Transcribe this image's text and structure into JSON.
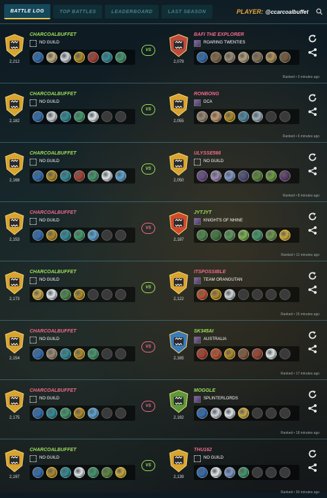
{
  "nav": {
    "tabs": [
      "BATTLE LOG",
      "TOP BATTLES",
      "LEADERBOARD",
      "LAST SEASON"
    ],
    "player_label": "PLAYER:",
    "player_name": "@ccarcoalbuffet"
  },
  "colors": {
    "win": "#9ee05a",
    "loss": "#f06a8a",
    "accent": "#e9a83a"
  },
  "battles": [
    {
      "result": "win",
      "vs": "VS",
      "ranked": "Ranked • 3 minutes ago",
      "left": {
        "name": "CHARCOALBUFFET",
        "guild": "NO GUILD",
        "rating": "2,212",
        "emblem": "gold-shield",
        "team": [
          "blue-splinter",
          "dragon",
          "wolf",
          "golden-warrior",
          "red-beast",
          "crab",
          "green-mage"
        ]
      },
      "right": {
        "name": "BAFI THE EXPLORER",
        "guild": "ROARING TWENTIES",
        "rating": "2,079",
        "emblem": "red-banner-shield",
        "team": [
          "blue-splinter",
          "beast",
          "golem",
          "fighter",
          "spearman",
          "shield-knight",
          "brown-beast"
        ]
      }
    },
    {
      "result": "win",
      "vs": "VS",
      "ranked": "Ranked • 6 minutes ago",
      "left": {
        "name": "CHARCOALBUFFET",
        "guild": "NO GUILD",
        "rating": "2,182",
        "emblem": "gold-shield",
        "team": [
          "blue-splinter",
          "wolf",
          "crab",
          "green-mage",
          "white-spirit",
          "empty",
          "empty"
        ]
      },
      "right": {
        "name": "RONBONG",
        "guild": "DCA",
        "rating": "2,055",
        "emblem": "gold-shield",
        "team": [
          "golem",
          "cat",
          "golden-warrior",
          "sea-creature",
          "mage",
          "empty",
          "empty"
        ]
      }
    },
    {
      "result": "win",
      "vs": "VS",
      "ranked": "Ranked • 8 minutes ago",
      "left": {
        "name": "CHARCOALBUFFET",
        "guild": "NO GUILD",
        "rating": "2,168",
        "emblem": "gold-shield",
        "team": [
          "blue-splinter",
          "golden-warrior",
          "crab",
          "red-beast",
          "green-mage",
          "white-spirit",
          "blue-mage"
        ]
      },
      "right": {
        "name": "ULYSSE566",
        "guild": "NO GUILD",
        "rating": "2,050",
        "emblem": "gold-shield",
        "team": [
          "purple-demon",
          "ghost",
          "spirit",
          "dark-knight",
          "beetle",
          "green-lizard",
          "shadow"
        ]
      }
    },
    {
      "result": "loss",
      "vs": "VS",
      "ranked": "Ranked • 11 minutes ago",
      "left": {
        "name": "CHARCOALBUFFET",
        "guild": "NO GUILD",
        "rating": "2,153",
        "emblem": "gold-shield",
        "team": [
          "blue-splinter",
          "golden-warrior",
          "crab",
          "green-mage",
          "blue-mage",
          "empty",
          "empty"
        ]
      },
      "right": {
        "name": "JYTJYT",
        "guild": "KNIGHTS OF NHINE",
        "rating": "2,187",
        "emblem": "fire-shield",
        "team": [
          "green-beast",
          "plant",
          "tree-spirit",
          "leaf",
          "green-mage",
          "shaman",
          "golden-elf"
        ]
      }
    },
    {
      "result": "win",
      "vs": "VS",
      "ranked": "Ranked • 15 minutes ago",
      "left": {
        "name": "CHARCOALBUFFET",
        "guild": "NO GUILD",
        "rating": "2,173",
        "emblem": "gold-shield",
        "team": [
          "golden-mage",
          "white-spirit",
          "green-beast",
          "golden-warrior",
          "empty",
          "empty",
          "empty"
        ]
      },
      "right": {
        "name": "ITSPOSSIBLE",
        "guild": "TEAM ORANGUTAN",
        "rating": "2,122",
        "emblem": "gold-shield",
        "team": [
          "fire-beast",
          "golden-warrior",
          "wolf",
          "empty",
          "empty",
          "empty",
          "empty"
        ]
      }
    },
    {
      "result": "loss",
      "vs": "VS",
      "ranked": "Ranked • 17 minutes ago",
      "left": {
        "name": "CHARCOALBUFFET",
        "guild": "NO GUILD",
        "rating": "2,154",
        "emblem": "gold-shield",
        "team": [
          "blue-splinter",
          "golem",
          "crab",
          "golden-warrior",
          "green-mage",
          "empty",
          "empty"
        ]
      },
      "right": {
        "name": "SK345AI",
        "guild": "AUSTRALIA",
        "rating": "2,165",
        "emblem": "blue-shield",
        "team": [
          "red-dragon",
          "fire-beast",
          "golden-warrior",
          "warrior",
          "red-mage",
          "white-spirit",
          "empty"
        ]
      }
    },
    {
      "result": "loss",
      "vs": "VS",
      "ranked": "Ranked • 18 minutes ago",
      "left": {
        "name": "CHARCOALBUFFET",
        "guild": "NO GUILD",
        "rating": "2,175",
        "emblem": "gold-shield",
        "team": [
          "blue-splinter",
          "crab",
          "green-mage",
          "golden-warrior",
          "blue-mage",
          "empty",
          "empty"
        ]
      },
      "right": {
        "name": "MOGGLE",
        "guild": "SPLINTERLORDS",
        "rating": "2,182",
        "emblem": "green-red-shield",
        "team": [
          "blue-splinter",
          "wolf",
          "white-spirit",
          "golden-mage",
          "empty",
          "empty",
          "empty"
        ]
      }
    },
    {
      "result": "win",
      "vs": "VS",
      "ranked": "Ranked • 30 minutes ago",
      "left": {
        "name": "CHARCOALBUFFET",
        "guild": "NO GUILD",
        "rating": "2,197",
        "emblem": "gold-shield",
        "team": [
          "blue-splinter",
          "golden-warrior",
          "crab",
          "white-spirit",
          "green-mage",
          "beetle",
          "golden-elf"
        ]
      },
      "right": {
        "name": "THU162",
        "guild": "NO GUILD",
        "rating": "2,139",
        "emblem": "gold-shield",
        "team": [
          "blue-splinter",
          "white-spirit",
          "spirit",
          "green-mage",
          "empty",
          "empty",
          "empty"
        ]
      }
    }
  ]
}
